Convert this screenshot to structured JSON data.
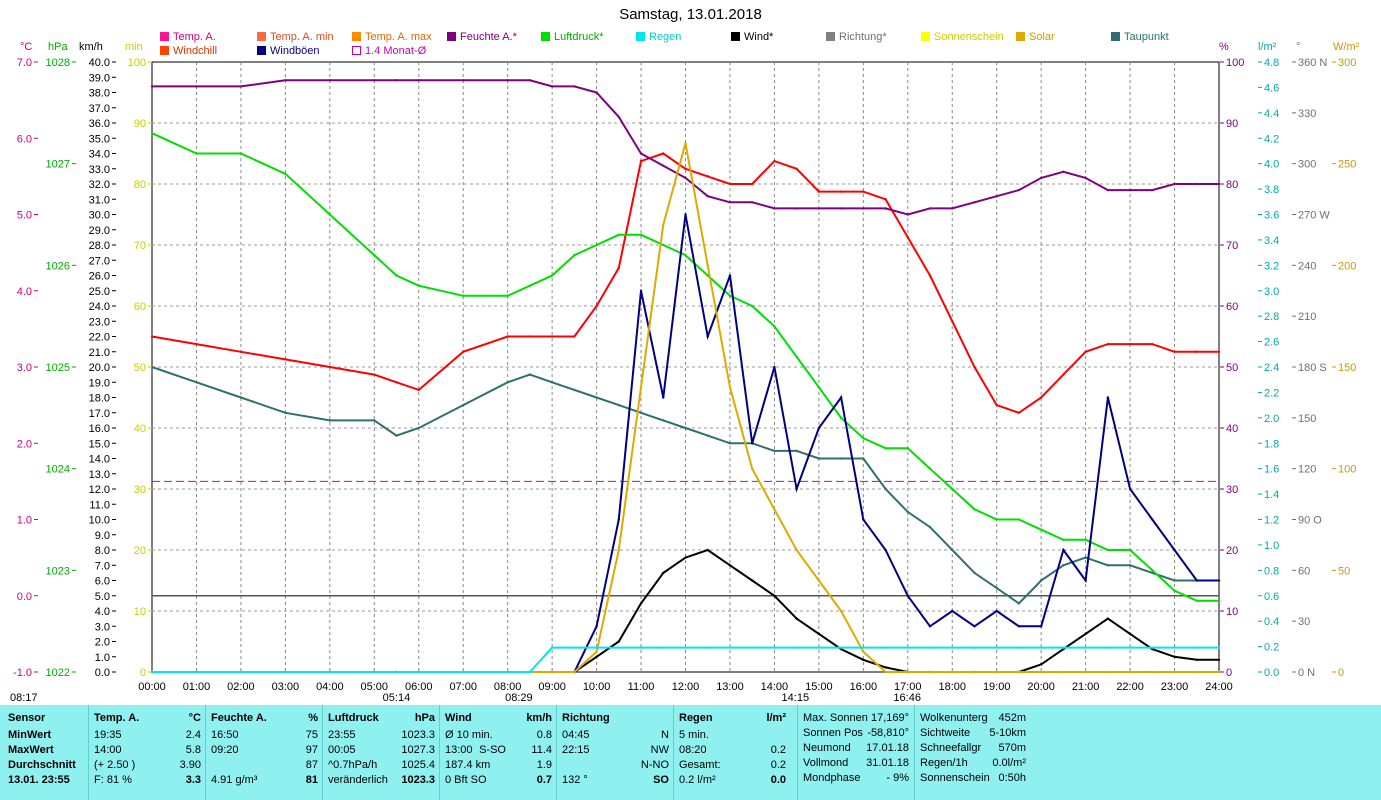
{
  "title": "Samstag, 13.01.2018",
  "legend": [
    {
      "label": "Temp. A.",
      "color": "#ff1493",
      "text_color": "#cc0080"
    },
    {
      "label": "Temp. A. min",
      "color": "#ff6a3d",
      "text_color": "#e04a20"
    },
    {
      "label": "Temp. A. max",
      "color": "#ff8c00",
      "text_color": "#e06a00"
    },
    {
      "label": "Feuchte A.*",
      "color": "#800080",
      "text_color": "#800080"
    },
    {
      "label": "Luftdruck*",
      "color": "#00dd00",
      "text_color": "#00aa00"
    },
    {
      "label": "Regen",
      "color": "#00e5ee",
      "text_color": "#00cccc"
    },
    {
      "label": "Wind*",
      "color": "#000000",
      "text_color": "#000000"
    },
    {
      "label": "Richtung*",
      "color": "#808080",
      "text_color": "#707070"
    },
    {
      "label": "Sonnenschein",
      "color": "#ffff00",
      "text_color": "#cccc00"
    },
    {
      "label": "Solar",
      "color": "#ddaa00",
      "text_color": "#cc9900"
    },
    {
      "label": "Taupunkt",
      "color": "#2f6f6f",
      "text_color": "#2f6f6f"
    },
    {
      "label": "Windchill",
      "color": "#ff4500",
      "text_color": "#e03000"
    },
    {
      "label": "Windböen",
      "color": "#000080",
      "text_color": "#000080"
    },
    {
      "label": "1.4 Monat-Ø",
      "color": "#cc00aa",
      "text_color": "#cc00aa",
      "hollow": true
    }
  ],
  "axis_units": {
    "temp": "°C",
    "pressure": "hPa",
    "wind": "km/h",
    "sun_min": "min",
    "humidity": "%",
    "rain": "l/m²",
    "direction": "°",
    "solar": "W/m²"
  },
  "axis_ticks": {
    "temp": [
      "7.0",
      "6.0",
      "5.0",
      "4.0",
      "3.0",
      "2.0",
      "1.0",
      "0.0",
      "-1.0"
    ],
    "pressure": [
      "1028",
      "1027",
      "1026",
      "1025",
      "1024",
      "1023",
      "1022"
    ],
    "wind": [
      "40.0",
      "39.0",
      "38.0",
      "37.0",
      "36.0",
      "35.0",
      "34.0",
      "33.0",
      "32.0",
      "31.0",
      "30.0",
      "29.0",
      "28.0",
      "27.0",
      "26.0",
      "25.0",
      "24.0",
      "23.0",
      "22.0",
      "21.0",
      "20.0",
      "19.0",
      "18.0",
      "17.0",
      "16.0",
      "15.0",
      "14.0",
      "13.0",
      "12.0",
      "11.0",
      "10.0",
      "9.0",
      "8.0",
      "7.0",
      "6.0",
      "5.0",
      "4.0",
      "3.0",
      "2.0",
      "1.0",
      "0.0"
    ],
    "sun_min": [
      "100",
      "90",
      "80",
      "70",
      "60",
      "50",
      "40",
      "30",
      "20",
      "10",
      "0"
    ],
    "humidity": [
      "100",
      "90",
      "80",
      "70",
      "60",
      "50",
      "40",
      "30",
      "20",
      "10",
      "0"
    ],
    "rain": [
      "4.8",
      "4.6",
      "4.4",
      "4.2",
      "4.0",
      "3.8",
      "3.6",
      "3.4",
      "3.2",
      "3.0",
      "2.8",
      "2.6",
      "2.4",
      "2.2",
      "2.0",
      "1.8",
      "1.6",
      "1.4",
      "1.2",
      "1.0",
      "0.8",
      "0.6",
      "0.4",
      "0.2",
      "0.0"
    ],
    "direction": [
      "360 N",
      "330",
      "300",
      "270 W",
      "240",
      "210",
      "180 S",
      "150",
      "120",
      "90 O",
      "60",
      "30",
      "0 N"
    ],
    "solar": [
      "300",
      "250",
      "200",
      "150",
      "100",
      "50",
      "0"
    ],
    "time": [
      "00:00",
      "01:00",
      "02:00",
      "03:00",
      "04:00",
      "05:00",
      "06:00",
      "07:00",
      "08:00",
      "09:00",
      "10:00",
      "11:00",
      "12:00",
      "13:00",
      "14:00",
      "15:00",
      "16:00",
      "17:00",
      "18:00",
      "19:00",
      "20:00",
      "21:00",
      "22:00",
      "23:00",
      "24:00"
    ]
  },
  "markers": {
    "sunrise": "08:17",
    "low_1": "05:14",
    "rain_start": "08:29",
    "wind_max": "14:15",
    "sunset": "16:46"
  },
  "chart_data": {
    "type": "line",
    "title": "Samstag, 13.01.2018",
    "x_hours": [
      0,
      1,
      2,
      3,
      4,
      5,
      5.5,
      6,
      7,
      8,
      8.5,
      9,
      9.5,
      10,
      10.5,
      11,
      11.5,
      12,
      12.5,
      13,
      13.5,
      14,
      14.5,
      15,
      15.5,
      16,
      16.5,
      17,
      17.5,
      18,
      18.5,
      19,
      19.5,
      20,
      20.5,
      21,
      21.5,
      22,
      22.5,
      23,
      23.5,
      24
    ],
    "series": [
      {
        "name": "Temp. A.",
        "axis": "temp",
        "color": "#ff0000",
        "values": [
          3.4,
          3.3,
          3.2,
          3.1,
          3.0,
          2.9,
          2.8,
          2.7,
          3.2,
          3.4,
          3.4,
          3.4,
          3.4,
          3.8,
          4.3,
          5.7,
          5.8,
          5.6,
          5.5,
          5.4,
          5.4,
          5.7,
          5.6,
          5.3,
          5.3,
          5.3,
          5.2,
          4.7,
          4.2,
          3.6,
          3.0,
          2.5,
          2.4,
          2.6,
          2.9,
          3.2,
          3.3,
          3.3,
          3.3,
          3.2,
          3.2,
          3.2
        ]
      },
      {
        "name": "Taupunkt",
        "axis": "temp",
        "color": "#2f6f6f",
        "values": [
          3.0,
          2.8,
          2.6,
          2.4,
          2.3,
          2.3,
          2.1,
          2.2,
          2.5,
          2.8,
          2.9,
          2.8,
          2.7,
          2.6,
          2.5,
          2.4,
          2.3,
          2.2,
          2.1,
          2.0,
          2.0,
          1.9,
          1.9,
          1.8,
          1.8,
          1.8,
          1.4,
          1.1,
          0.9,
          0.6,
          0.3,
          0.1,
          -0.1,
          0.2,
          0.4,
          0.5,
          0.4,
          0.4,
          0.3,
          0.2,
          0.2,
          0.2
        ]
      },
      {
        "name": "Feuchte A.*",
        "axis": "humidity",
        "color": "#800080",
        "values": [
          96,
          96,
          96,
          97,
          97,
          97,
          97,
          97,
          97,
          97,
          97,
          96,
          96,
          95,
          91,
          85,
          83,
          81,
          78,
          77,
          77,
          76,
          76,
          76,
          76,
          76,
          76,
          75,
          76,
          76,
          77,
          78,
          79,
          81,
          82,
          81,
          79,
          79,
          79,
          80,
          80,
          80
        ]
      },
      {
        "name": "Luftdruck*",
        "axis": "pressure",
        "color": "#00dd00",
        "values": [
          1027.3,
          1027.1,
          1027.1,
          1026.9,
          1026.5,
          1026.1,
          1025.9,
          1025.8,
          1025.7,
          1025.7,
          1025.8,
          1025.9,
          1026.1,
          1026.2,
          1026.3,
          1026.3,
          1026.2,
          1026.1,
          1025.9,
          1025.7,
          1025.6,
          1025.4,
          1025.1,
          1024.8,
          1024.5,
          1024.3,
          1024.2,
          1024.2,
          1024.0,
          1023.8,
          1023.6,
          1023.5,
          1023.5,
          1023.4,
          1023.3,
          1023.3,
          1023.2,
          1023.2,
          1023.0,
          1022.8,
          1022.7,
          1022.7
        ]
      },
      {
        "name": "Wind*",
        "axis": "wind",
        "color": "#000000",
        "values": [
          0,
          0,
          0,
          0,
          0,
          0,
          0,
          0,
          0,
          0,
          0,
          0,
          0,
          1.0,
          2.0,
          4.5,
          6.5,
          7.5,
          8.0,
          7.0,
          6.0,
          5.0,
          3.5,
          2.5,
          1.5,
          0.8,
          0.3,
          0,
          0,
          0,
          0,
          0,
          0,
          0.5,
          1.5,
          2.5,
          3.5,
          2.5,
          1.5,
          1.0,
          0.8,
          0.8
        ]
      },
      {
        "name": "Windböen",
        "axis": "wind",
        "color": "#000080",
        "values": [
          0,
          0,
          0,
          0,
          0,
          0,
          0,
          0,
          0,
          0,
          0,
          0,
          0,
          3,
          10,
          25,
          18,
          30,
          22,
          26,
          15,
          20,
          12,
          16,
          18,
          10,
          8,
          5,
          3,
          4,
          3,
          4,
          3,
          3,
          8,
          6,
          18,
          12,
          10,
          8,
          6,
          6
        ]
      },
      {
        "name": "Solar",
        "axis": "solar",
        "color": "#ddaa00",
        "values": [
          0,
          0,
          0,
          0,
          0,
          0,
          0,
          0,
          0,
          0,
          0,
          0,
          0,
          10,
          60,
          140,
          220,
          260,
          200,
          140,
          100,
          80,
          60,
          45,
          30,
          10,
          0,
          0,
          0,
          0,
          0,
          0,
          0,
          0,
          0,
          0,
          0,
          0,
          0,
          0,
          0,
          0
        ]
      },
      {
        "name": "Regen",
        "axis": "rain",
        "color": "#00e5ee",
        "values": [
          0,
          0,
          0,
          0,
          0,
          0,
          0,
          0,
          0,
          0,
          0,
          0.2,
          0.2,
          0.2,
          0.2,
          0.2,
          0.2,
          0.2,
          0.2,
          0.2,
          0.2,
          0.2,
          0.2,
          0.2,
          0.2,
          0.2,
          0.2,
          0.2,
          0.2,
          0.2,
          0.2,
          0.2,
          0.2,
          0.2,
          0.2,
          0.2,
          0.2,
          0.2,
          0.2,
          0.2,
          0.2,
          0.2
        ]
      }
    ],
    "reference_lines": [
      {
        "name": "1.4 Monat-Ø",
        "axis": "temp",
        "value": 1.5,
        "color": "#cc00aa"
      }
    ]
  },
  "stats": {
    "sensor": {
      "header": "Sensor",
      "rows": [
        "MinWert",
        "MaxWert",
        "Durchschnitt"
      ],
      "footer": "13.01. 23:55"
    },
    "temp": {
      "header": "Temp. A.",
      "unit": "°C",
      "rows": [
        [
          "19:35",
          "2.4"
        ],
        [
          "14:00",
          "5.8"
        ],
        [
          "(+ 2.50 )",
          "3.90"
        ]
      ],
      "footer_label": "F: 81 %",
      "footer_value": "3.3"
    },
    "humidity": {
      "header": "Feuchte A.",
      "unit": "%",
      "rows": [
        [
          "16:50",
          "75"
        ],
        [
          "09:20",
          "97"
        ],
        [
          "",
          "87"
        ]
      ],
      "footer_label": "4.91 g/m³",
      "footer_value": "81"
    },
    "pressure": {
      "header": "Luftdruck",
      "unit": "hPa",
      "rows": [
        [
          "23:55",
          "1023.3"
        ],
        [
          "00:05",
          "1027.3"
        ],
        [
          "^0.7hPa/h",
          "1025.4"
        ]
      ],
      "footer_label": "veränderlich",
      "footer_value": "1023.3"
    },
    "wind": {
      "header": "Wind",
      "unit": "km/h",
      "rows": [
        [
          "Ø 10 min.",
          "",
          "0.8"
        ],
        [
          "13:00",
          "S-SO",
          "11.4"
        ],
        [
          "187.4 km",
          "",
          "1.9"
        ]
      ],
      "footer_label": "0 Bft SO",
      "footer_value": "0.7"
    },
    "direction": {
      "header": "Richtung",
      "rows": [
        [
          "04:45",
          "N"
        ],
        [
          "22:15",
          "NW"
        ],
        [
          "",
          "N-NO"
        ]
      ],
      "footer_label": "132 °",
      "footer_value": "SO"
    },
    "rain": {
      "header": "Regen",
      "unit": "l/m²",
      "rows": [
        [
          "5 min.",
          ""
        ],
        [
          "08:20",
          "0.2"
        ],
        [
          "Gesamt:",
          "0.2"
        ]
      ],
      "footer_label": "0.2 l/m²",
      "footer_value": "0.0"
    },
    "astro": [
      [
        "Max. Sonnen",
        "17,169°"
      ],
      [
        "Sonnen Pos",
        "-58,810°"
      ],
      [
        "Neumond",
        "17.01.18"
      ],
      [
        "Vollmond",
        "31.01.18"
      ],
      [
        "Mondphase",
        "- 9%"
      ]
    ],
    "misc": [
      [
        "Wolkenunterg",
        "452m"
      ],
      [
        "Sichtweite",
        "5-10km"
      ],
      [
        "Schneefallgr",
        "570m"
      ],
      [
        "Regen/1h",
        "0.0l/m²"
      ],
      [
        "Sonnenschein",
        "0:50h"
      ]
    ]
  }
}
